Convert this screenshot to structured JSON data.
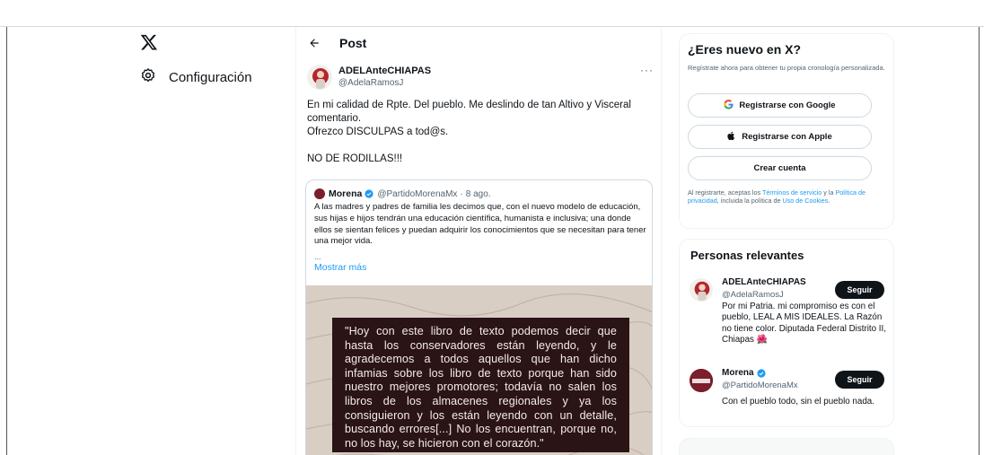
{
  "nav": {
    "logo_icon": "x-logo-icon",
    "settings_icon": "gear-icon",
    "settings_label": "Configuración"
  },
  "post": {
    "header_title": "Post",
    "back_icon": "arrow-left-icon",
    "author": {
      "name": "ADELAnteCHIAPAS",
      "handle": "@AdelaRamosJ"
    },
    "more_label": "···",
    "text_lines": [
      "En mi calidad de Rpte. Del pueblo. Me deslindo de tan Altivo y Visceral",
      "comentario.",
      "Ofrezco DISCULPAS a tod@s.",
      "",
      "NO DE RODILLAS!!!"
    ],
    "quote": {
      "name": "Morena",
      "verified_icon": "verified-badge-icon",
      "handle": "@PartidoMorenaMx",
      "dot": "·",
      "date": "8 ago.",
      "text": "A las madres y padres de familia les decimos que, con el nuevo modelo de educación, sus hijas e hijos tendrán una educación científica, humanista e inclusiva; una donde ellos se sientan felices y puedan adquirir los conocimientos que se necesitan para tener una mejor vida.",
      "ellipsis": "...",
      "show_more": "Mostrar más",
      "image_quote": "\"Hoy con este libro de texto podemos decir que hasta los conservadores están leyendo, y le agradecemos a todos aquellos que han dicho infamias sobre los libro de texto porque han sido nuestro mejores promotores; todavía no salen los libros de los almacenes regionales y ya los consiguieron y los están leyendo con un detalle, buscando errores[...] No los encuentran, porque no, no los hay, se hicieron con el corazón.\""
    }
  },
  "signup": {
    "title": "¿Eres nuevo en X?",
    "subtitle": "Regístrate ahora para obtener tu propia cronología personalizada.",
    "google_label": "Registrarse con Google",
    "apple_label": "Registrarse con Apple",
    "create_label": "Crear cuenta",
    "legal_1": "Al registrarte, aceptas los ",
    "legal_terms": "Términos de servicio",
    "legal_2": " y la ",
    "legal_privacy": "Política de privacidad",
    "legal_3": ", incluida la política de ",
    "legal_cookies": "Uso de Cookies",
    "legal_4": "."
  },
  "relevant": {
    "title": "Personas relevantes",
    "people": [
      {
        "name": "ADELAnteCHIAPAS",
        "handle": "@AdelaRamosJ",
        "follow_label": "Seguir",
        "bio": "Por mi Patria. mi compromiso es con el pueblo, LEAL A MIS IDEALES. La Razón no tiene color. Diputada Federal Distrito II, Chiapas 🌺"
      },
      {
        "name": "Morena",
        "handle": "@PartidoMorenaMx",
        "follow_label": "Seguir",
        "bio": "Con el pueblo todo, sin el pueblo nada."
      }
    ]
  },
  "colors": {
    "accent": "#1d9bf0",
    "quote_box": "#2a1416",
    "morena": "#7a1f2b"
  }
}
